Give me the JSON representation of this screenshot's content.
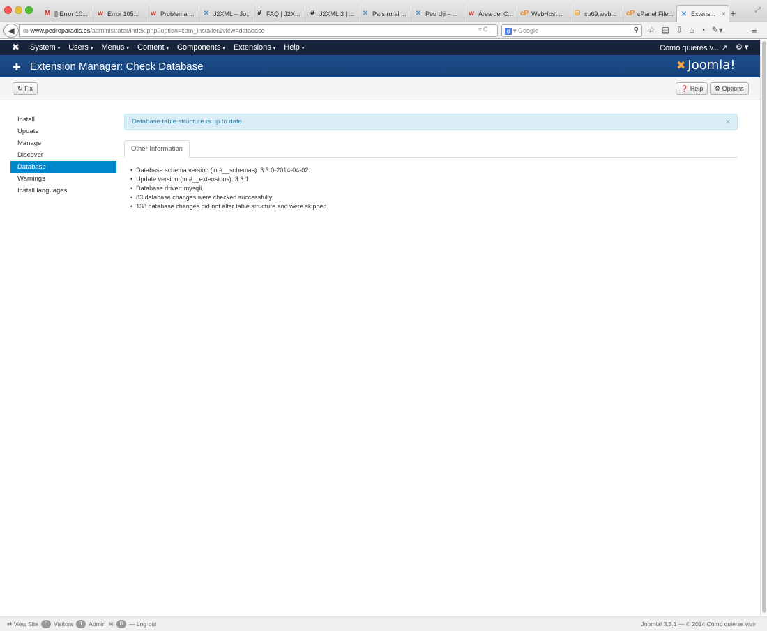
{
  "browser": {
    "tabs": [
      {
        "label": "[] Error 10...",
        "icon": "gmail-icon",
        "icon_glyph": "M",
        "color": "#d93025"
      },
      {
        "label": "Error 105...",
        "icon": "w-icon",
        "icon_glyph": "w",
        "color": "#c0392b"
      },
      {
        "label": "Problema ...",
        "icon": "w-icon",
        "icon_glyph": "w",
        "color": "#c0392b"
      },
      {
        "label": "J2XML – Jo...",
        "icon": "joomla-icon",
        "icon_glyph": "✕",
        "color": "#5091cd"
      },
      {
        "label": "FAQ | J2X...",
        "icon": "hash-icon",
        "icon_glyph": "#",
        "color": "#222"
      },
      {
        "label": "J2XML 3 | ...",
        "icon": "hash-icon",
        "icon_glyph": "#",
        "color": "#222"
      },
      {
        "label": "País rural ...",
        "icon": "joomla-icon",
        "icon_glyph": "✕",
        "color": "#5091cd"
      },
      {
        "label": "Peu Uji – ...",
        "icon": "joomla-icon",
        "icon_glyph": "✕",
        "color": "#5091cd"
      },
      {
        "label": "Área del C...",
        "icon": "w-icon",
        "icon_glyph": "w",
        "color": "#c0392b"
      },
      {
        "label": "WebHost ...",
        "icon": "cpanel-icon",
        "icon_glyph": "cP",
        "color": "#f28c28"
      },
      {
        "label": "cp69.web...",
        "icon": "pma-icon",
        "icon_glyph": "⛁",
        "color": "#f0a030"
      },
      {
        "label": "cPanel File...",
        "icon": "cpanel-icon",
        "icon_glyph": "cP",
        "color": "#f28c28"
      },
      {
        "label": "Extens...",
        "icon": "joomla-icon",
        "icon_glyph": "✕",
        "color": "#5091cd",
        "active": true
      }
    ],
    "url_host": "www.pedroparadis.es",
    "url_path": "/administrator/index.php?option=com_installer&view=database",
    "search_placeholder": "Google"
  },
  "joomla": {
    "menu": [
      "System",
      "Users",
      "Menus",
      "Content",
      "Components",
      "Extensions",
      "Help"
    ],
    "user_menu": "Cómo quieres v...",
    "page_title": "Extension Manager: Check Database",
    "brand": "Joomla!",
    "toolbar": {
      "fix": "Fix",
      "help": "Help",
      "options": "Options"
    },
    "sidebar": [
      {
        "label": "Install",
        "active": false
      },
      {
        "label": "Update",
        "active": false
      },
      {
        "label": "Manage",
        "active": false
      },
      {
        "label": "Discover",
        "active": false
      },
      {
        "label": "Database",
        "active": true
      },
      {
        "label": "Warnings",
        "active": false
      },
      {
        "label": "Install languages",
        "active": false
      }
    ],
    "alert": "Database table structure is up to date.",
    "tab_label": "Other Information",
    "info": [
      "Database schema version (in #__schemas): 3.3.0-2014-04-02.",
      "Update version (in #__extensions): 3.3.1.",
      "Database driver: mysqli.",
      "83 database changes were checked successfully.",
      "138 database changes did not alter table structure and were skipped."
    ],
    "status": {
      "view_site": "View Site",
      "visitors_count": "0",
      "visitors": "Visitors",
      "admin_count": "1",
      "admin": "Admin",
      "messages_count": "0",
      "logout": "Log out",
      "footer": "Joomla! 3.3.1  —  © 2014 Cómo quieres vivir"
    },
    "colors": {
      "navbar": "#17233a",
      "header": "#1d4e8a",
      "active": "#0088cc",
      "alert_bg": "#d9edf7"
    }
  }
}
